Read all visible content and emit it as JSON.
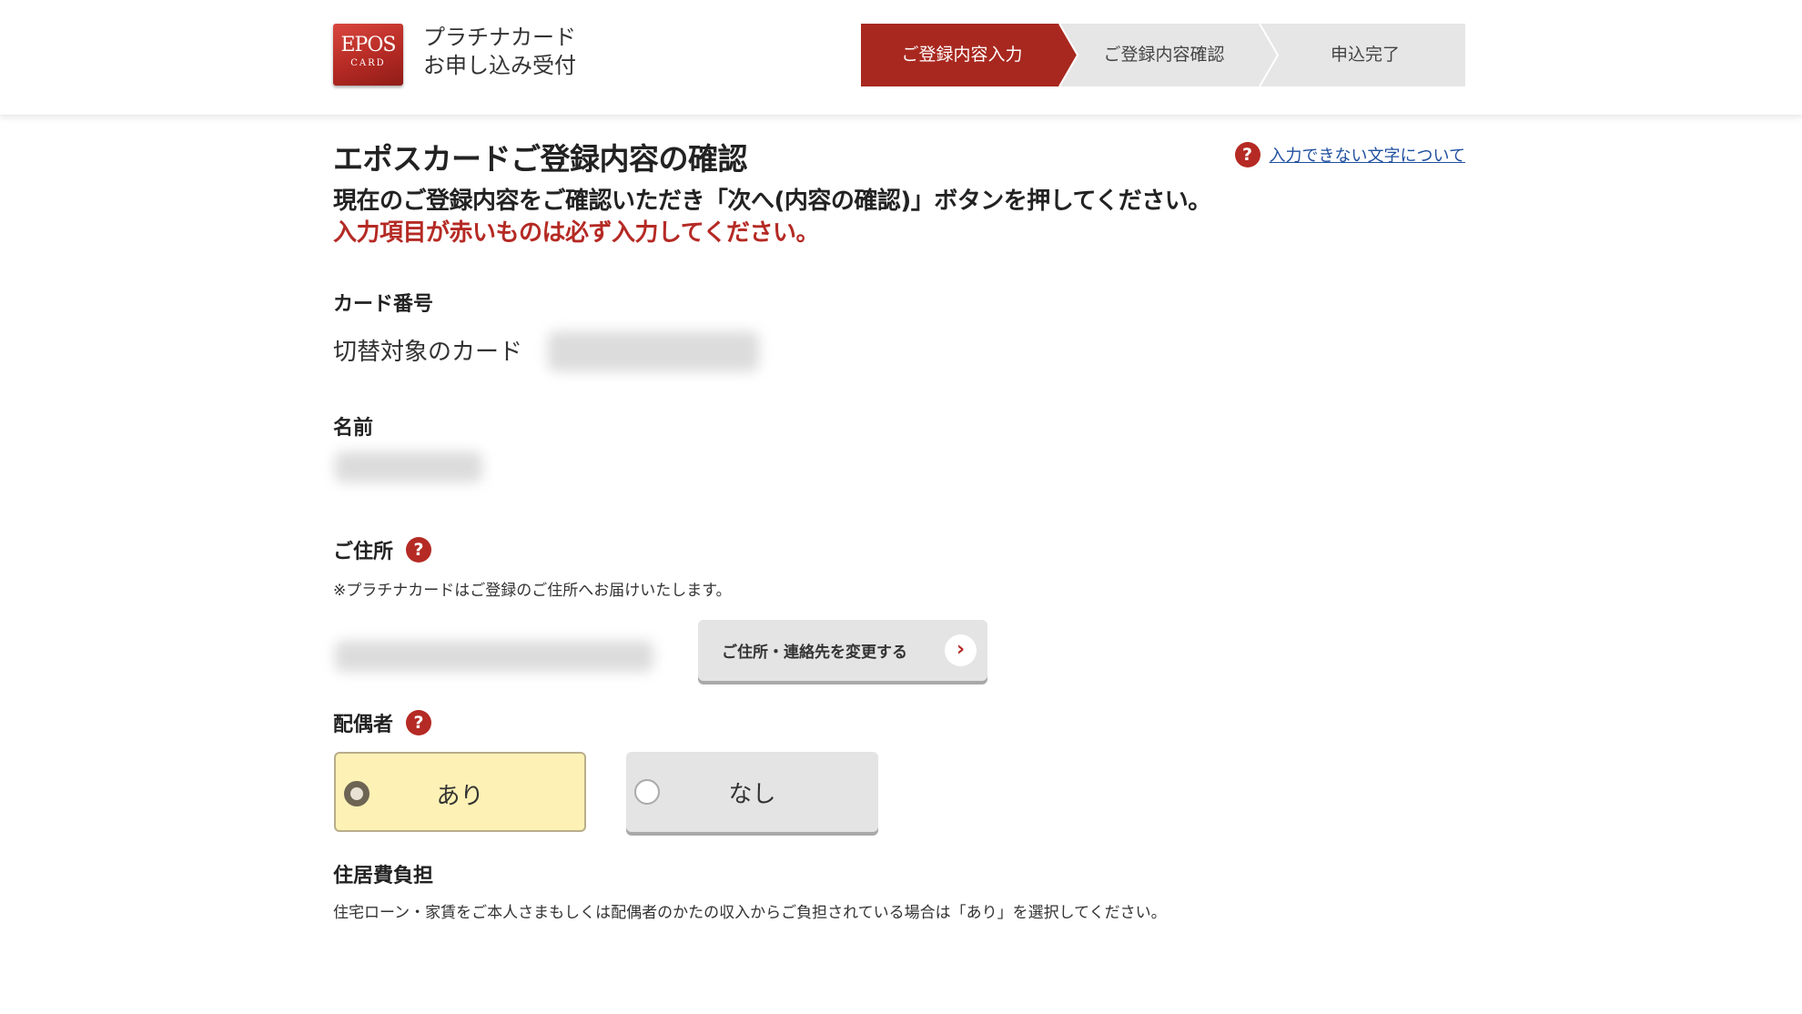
{
  "header": {
    "logo": {
      "line1": "EPOS",
      "line2": "CARD"
    },
    "app_title": [
      "プラチナカード",
      "お申し込み受付"
    ],
    "steps": [
      {
        "label": "ご登録内容入力",
        "active": true
      },
      {
        "label": "ご登録内容確認",
        "active": false
      },
      {
        "label": "申込完了",
        "active": false
      }
    ],
    "colors": {
      "accent": "#a8281f",
      "step_inactive": "#e6e6e6"
    }
  },
  "main": {
    "title": "エポスカードご登録内容の確認",
    "help_link": {
      "icon": "question-icon",
      "label": "入力できない文字について"
    },
    "lead": "現在のご登録内容をご確認いただき「次へ(内容の確認)」ボタンを押してください。",
    "lead_required": "入力項目が赤いものは必ず入力してください。",
    "card_section": {
      "label": "カード番号",
      "target_label": "切替対象のカード",
      "value": "(blurred)"
    },
    "name_section": {
      "label": "名前",
      "value": "(blurred)"
    },
    "address_section": {
      "label": "ご住所",
      "note": "※プラチナカードはご登録のご住所へお届けいたします。",
      "value": "(blurred)",
      "change_button": "ご住所・連絡先を変更する"
    },
    "spouse_section": {
      "label": "配偶者",
      "options": [
        {
          "label": "あり",
          "selected": true
        },
        {
          "label": "なし",
          "selected": false
        }
      ]
    },
    "housing_section": {
      "label": "住居費負担",
      "note": "住宅ローン・家賃をご本人さまもしくは配偶者のかたの収入からご負担されている場合は「あり」を選択してください。"
    }
  }
}
